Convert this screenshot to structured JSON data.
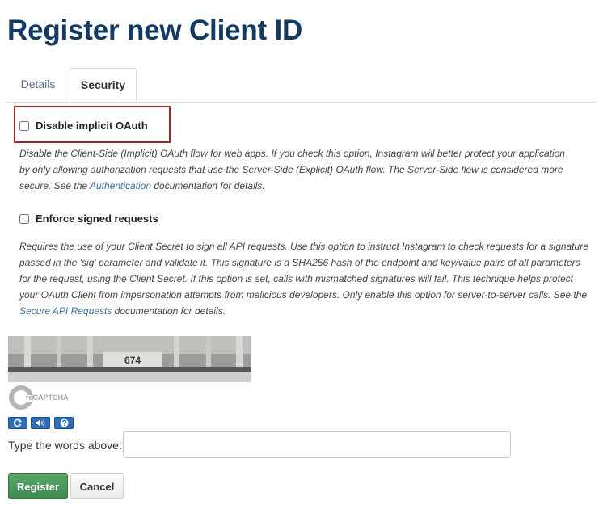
{
  "page": {
    "title": "Register new Client ID"
  },
  "tabs": [
    {
      "label": "Details",
      "active": false
    },
    {
      "label": "Security",
      "active": true
    }
  ],
  "security": {
    "implicit_oauth": {
      "label": "Disable implicit OAuth",
      "checked": false,
      "desc_before_link": "Disable the Client-Side (Implicit) OAuth flow for web apps. If you check this option, Instagram will better protect your application by only allowing authorization requests that use the Server-Side (Explicit) OAuth flow. The Server-Side flow is considered more secure. See the ",
      "link_text": "Authentication",
      "desc_after_link": " documentation for details."
    },
    "signed_requests": {
      "label": "Enforce signed requests",
      "checked": false,
      "desc_before_link": "Requires the use of your Client Secret to sign all API requests. Use this option to instruct Instagram to check requests for a signature passed in the 'sig' parameter and validate it. This signature is a SHA256 hash of the endpoint and key/value pairs of all parameters for the request, using the Client Secret. If this option is set, calls with mismatched signatures will fail. This technique helps protect your OAuth Client from impersonation attempts from malicious developers. Only enable this option for server-to-server calls. See the ",
      "link_text": "Secure API Requests",
      "desc_after_link": " documentation for details."
    }
  },
  "captcha": {
    "image_text": "674",
    "logo_text": "reCAPTCHA",
    "controls": [
      {
        "icon": "refresh-icon"
      },
      {
        "icon": "audio-icon"
      },
      {
        "icon": "help-icon"
      }
    ],
    "prompt_label": "Type the words above:",
    "input_value": ""
  },
  "actions": {
    "register_label": "Register",
    "cancel_label": "Cancel"
  },
  "colors": {
    "title": "#123a62",
    "link": "#3f729b",
    "highlight_border": "#9b2a2a",
    "register_button": "#4a9a5c",
    "captcha_button": "#2f6db5"
  }
}
